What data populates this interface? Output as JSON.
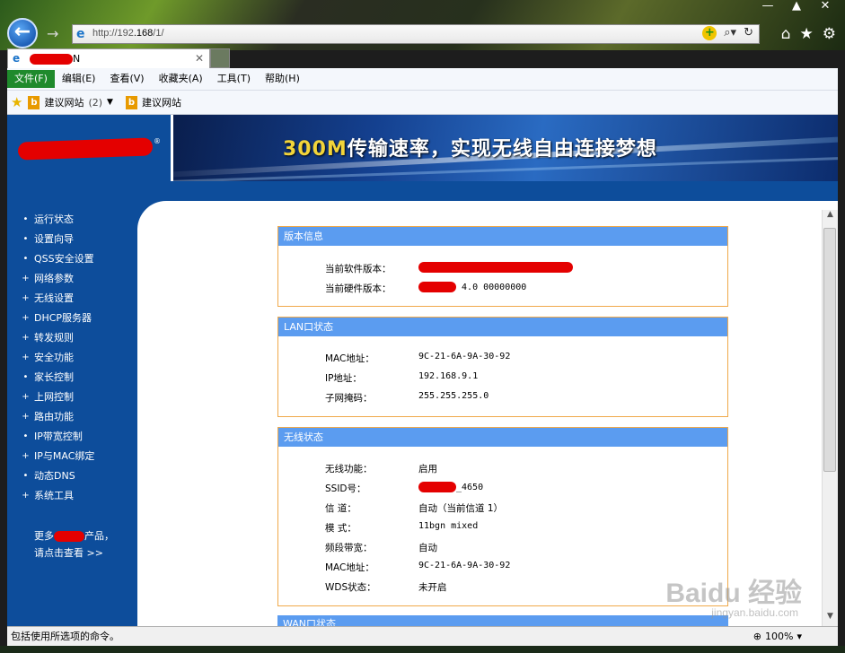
{
  "browser": {
    "url_prefix": "http://192",
    "url_mid": ".168",
    "url_rest": "/",
    "url_suffix": "1/",
    "tab_suffix": "N",
    "window_controls": [
      "—",
      "▲",
      "✕"
    ]
  },
  "menu": {
    "items": [
      "文件(F)",
      "编辑(E)",
      "查看(V)",
      "收藏夹(A)",
      "工具(T)",
      "帮助(H)"
    ]
  },
  "favorites": {
    "item1_label": "建议网站",
    "item1_count": "(2)",
    "item2_label": "建议网站"
  },
  "banner": {
    "slogan_highlight": "300M",
    "slogan_rest": "传输速率，实现无线自由连接梦想",
    "logo_mark": "®"
  },
  "sidebar": {
    "items": [
      {
        "label": "运行状态",
        "bullet": "•"
      },
      {
        "label": "设置向导",
        "bullet": "•"
      },
      {
        "label": "QSS安全设置",
        "bullet": "•"
      },
      {
        "label": "网络参数",
        "bullet": "+"
      },
      {
        "label": "无线设置",
        "bullet": "+"
      },
      {
        "label": "DHCP服务器",
        "bullet": "+"
      },
      {
        "label": "转发规则",
        "bullet": "+"
      },
      {
        "label": "安全功能",
        "bullet": "+"
      },
      {
        "label": "家长控制",
        "bullet": "•"
      },
      {
        "label": "上网控制",
        "bullet": "+"
      },
      {
        "label": "路由功能",
        "bullet": "+"
      },
      {
        "label": "IP带宽控制",
        "bullet": "•"
      },
      {
        "label": "IP与MAC绑定",
        "bullet": "+"
      },
      {
        "label": "动态DNS",
        "bullet": "•"
      },
      {
        "label": "系统工具",
        "bullet": "+"
      }
    ],
    "more_line1_a": "更多",
    "more_line1_b": "产品，",
    "more_line2": "请点击查看 >>"
  },
  "version_panel": {
    "title": "版本信息",
    "software_label": "当前软件版本：",
    "hardware_label": "当前硬件版本：",
    "hardware_value_tail": "4.0 00000000"
  },
  "lan_panel": {
    "title": "LAN口状态",
    "rows": [
      {
        "label": "MAC地址：",
        "value": "9C-21-6A-9A-30-92"
      },
      {
        "label": "IP地址：",
        "value": "192.168.9.1"
      },
      {
        "label": "子网掩码：",
        "value": "255.255.255.0"
      }
    ]
  },
  "wireless_panel": {
    "title": "无线状态",
    "rows": [
      {
        "label": "无线功能：",
        "value": "启用"
      },
      {
        "label": "SSID号：",
        "value": "_4650"
      },
      {
        "label": "信 道：",
        "value": "自动（当前信道 1）"
      },
      {
        "label": "模 式：",
        "value": "11bgn mixed"
      },
      {
        "label": "频段带宽：",
        "value": "自动"
      },
      {
        "label": "MAC地址：",
        "value": "9C-21-6A-9A-30-92"
      },
      {
        "label": "WDS状态：",
        "value": "未开启"
      }
    ]
  },
  "wan_panel": {
    "title": "WAN口状态"
  },
  "statusbar": {
    "text": "包括使用所选项的命令。",
    "zoom": "100%"
  },
  "watermark": {
    "line1": "Baidu 经验",
    "line2": "jingyan.baidu.com"
  },
  "colors": {
    "page_blue": "#0d4d9b",
    "panel_header": "#5b9cf0",
    "panel_border": "#f0a94a",
    "menu_active": "#1f8a2c"
  }
}
